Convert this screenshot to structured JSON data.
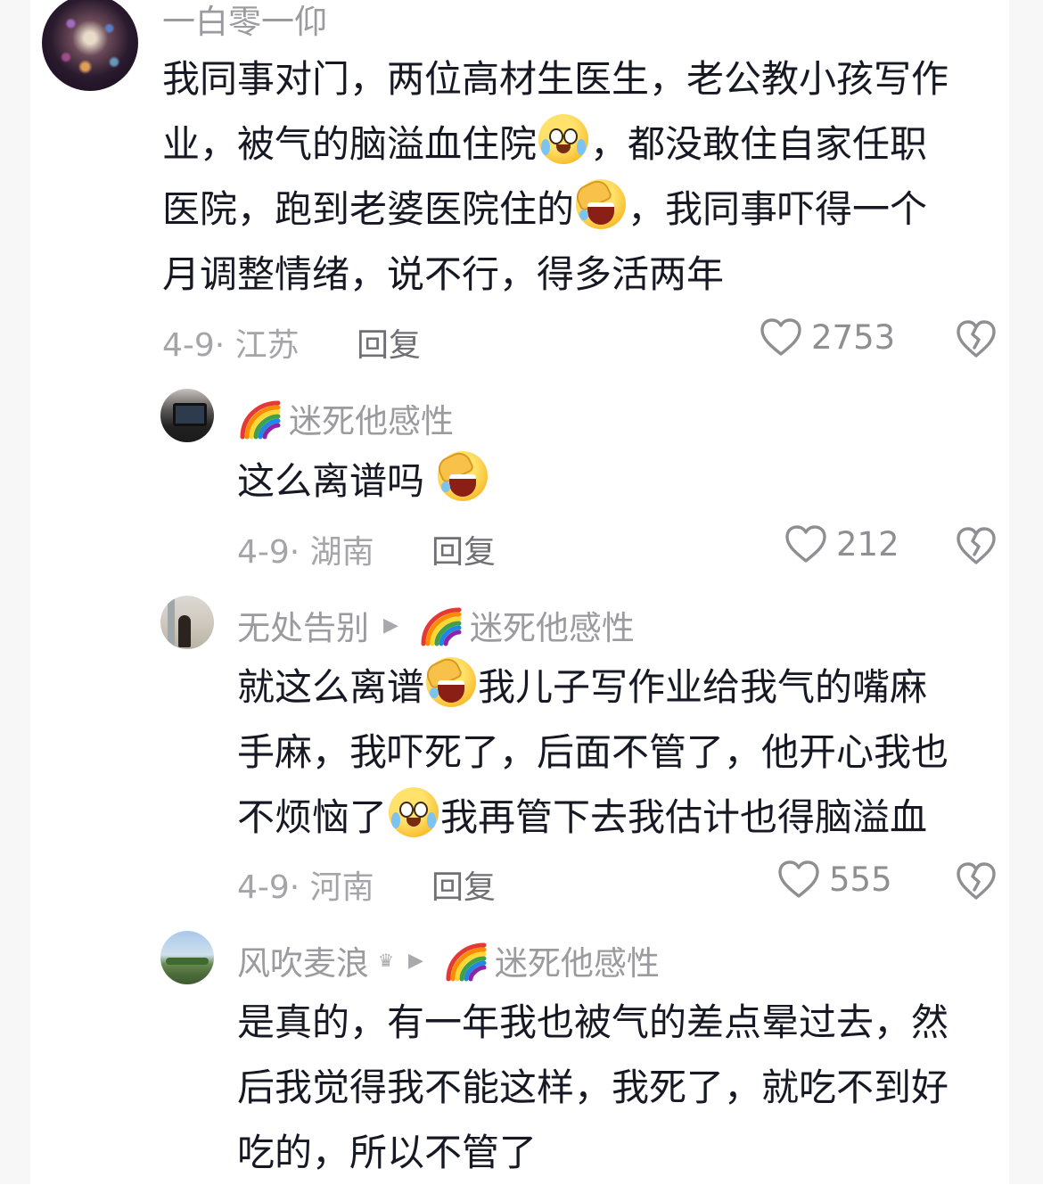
{
  "comments": [
    {
      "username": "一白零一仰",
      "lines": [
        {
          "t1": "我同事对门，两位高材生医生，老公教小孩写作"
        },
        {
          "t1": "业，被气的脑溢血住院",
          "emoji": "cry",
          "t2": "，都没敢住自家任职"
        },
        {
          "t1": "医院，跑到老婆医院住的",
          "emoji": "laugh",
          "t2": "，我同事吓得一个"
        },
        {
          "t1": "月调整情绪，说不行，得多活两年"
        }
      ],
      "meta": "4-9· 江苏",
      "reply_label": "回复",
      "likes": "2753"
    },
    {
      "username": "迷死他感性",
      "lines": [
        {
          "t1": "这么离谱吗 ",
          "emoji": "laugh"
        }
      ],
      "meta": "4-9· 湖南",
      "reply_label": "回复",
      "likes": "212"
    },
    {
      "username": "无处告别",
      "reply_to": "迷死他感性",
      "lines": [
        {
          "t1": "就这么离谱",
          "emoji": "laugh",
          "t2": "我儿子写作业给我气的嘴麻"
        },
        {
          "t1": "手麻，我吓死了，后面不管了，他开心我也"
        },
        {
          "t1": "不烦恼了",
          "emoji": "cry",
          "t2": "我再管下去我估计也得脑溢血"
        }
      ],
      "meta": "4-9· 河南",
      "reply_label": "回复",
      "likes": "555"
    },
    {
      "username": "风吹麦浪",
      "reply_to": "迷死他感性",
      "lines": [
        {
          "t1": "是真的，有一年我也被气的差点晕过去，然"
        },
        {
          "t1": "后我觉得我不能这样，我死了，就吃不到好"
        },
        {
          "t1": "吃的，所以不管了"
        }
      ]
    }
  ],
  "icons": {
    "like": "heart-outline-icon",
    "dislike": "broken-heart-icon",
    "reply_arrow": "triangle-right-icon",
    "badge": "rainbow-emoji",
    "crown": "crown-icon"
  },
  "colors": {
    "text": "#161823",
    "meta": "#a4a4a9",
    "reply": "#6f6f75"
  }
}
